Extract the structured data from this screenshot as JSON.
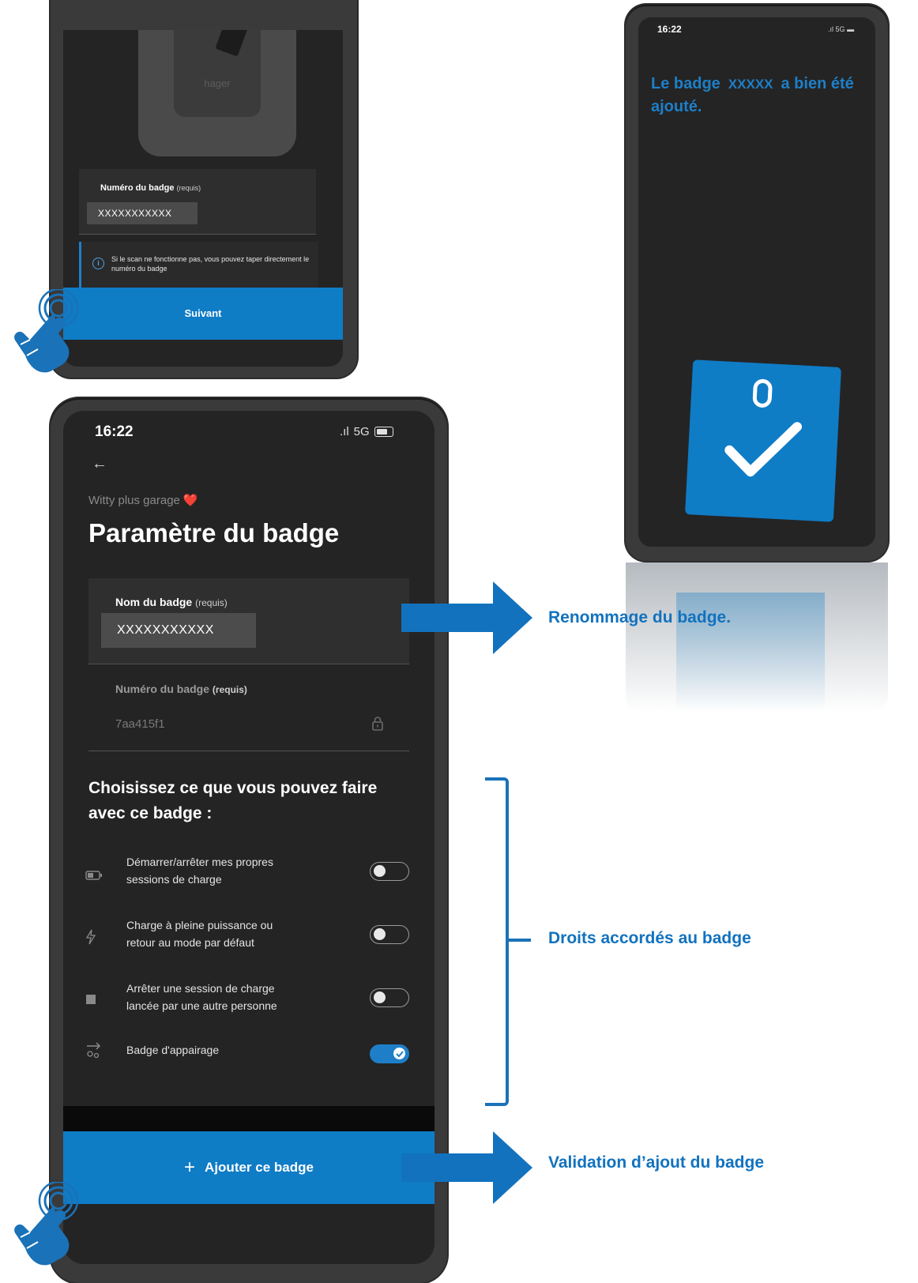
{
  "scan_screen": {
    "device_brand": "hager",
    "field_label": "Numéro du badge",
    "field_required": "(requis)",
    "field_value": "XXXXXXXXXXX",
    "info_text": "Si le scan ne fonctionne pas, vous pouvez taper directement le numéro du badge",
    "next_button": "Suivant"
  },
  "success_screen": {
    "time": "16:22",
    "status": "5G",
    "message_before": "Le badge",
    "badge_id": "XXXXX",
    "message_after": "a bien été ajouté."
  },
  "settings_screen": {
    "time": "16:22",
    "status": "5G",
    "back_icon": "arrow-left-icon",
    "subtitle": "Witty plus garage",
    "subtitle_emoji": "❤️",
    "title": "Paramètre du badge",
    "name_label": "Nom du badge",
    "name_required": "(requis)",
    "name_value": "XXXXXXXXXXX",
    "number_label": "Numéro du badge",
    "number_required": "(requis)",
    "number_value": "7aa415f1",
    "rights_title": "Choisissez ce que vous pouvez faire avec ce badge :",
    "rights": [
      {
        "label_line1": "Démarrer/arrêter mes propres",
        "label_line2": "sessions de charge",
        "icon": "battery-icon",
        "enabled": false
      },
      {
        "label_line1": "Charge à pleine puissance ou",
        "label_line2": "retour au mode par défaut",
        "icon": "lightning-icon",
        "enabled": false
      },
      {
        "label_line1": "Arrêter une session de charge",
        "label_line2": "lancée par une autre personne",
        "icon": "stop-icon",
        "enabled": false
      },
      {
        "label_line1": "Badge d'appairage",
        "label_line2": "",
        "icon": "pairing-icon",
        "enabled": true
      }
    ],
    "add_button": "Ajouter ce badge"
  },
  "annotations": {
    "rename": "Renommage du badge.",
    "rights": "Droits accordés au badge",
    "validate": "Validation d’ajout du badge"
  },
  "colors": {
    "accent": "#0f7cc6",
    "annotation": "#1272be",
    "screen_bg": "#242424"
  }
}
